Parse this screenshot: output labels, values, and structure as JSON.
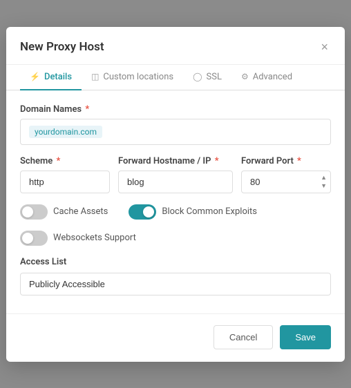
{
  "modal": {
    "title": "New Proxy Host",
    "close_label": "×"
  },
  "tabs": [
    {
      "id": "details",
      "label": "Details",
      "icon": "⚡",
      "active": true
    },
    {
      "id": "custom-locations",
      "label": "Custom locations",
      "icon": "◫",
      "active": false
    },
    {
      "id": "ssl",
      "label": "SSL",
      "icon": "◯",
      "active": false
    },
    {
      "id": "advanced",
      "label": "Advanced",
      "icon": "⚙",
      "active": false
    }
  ],
  "form": {
    "domain_names_label": "Domain Names",
    "domain_names_tag": "yourdomain.com",
    "scheme_label": "Scheme",
    "scheme_value": "http",
    "forward_hostname_label": "Forward Hostname / IP",
    "forward_hostname_value": "blog",
    "forward_port_label": "Forward Port",
    "forward_port_value": "80",
    "cache_assets_label": "Cache Assets",
    "block_exploits_label": "Block Common Exploits",
    "websockets_label": "Websockets Support",
    "access_list_label": "Access List",
    "access_list_value": "Publicly Accessible"
  },
  "footer": {
    "cancel_label": "Cancel",
    "save_label": "Save"
  }
}
